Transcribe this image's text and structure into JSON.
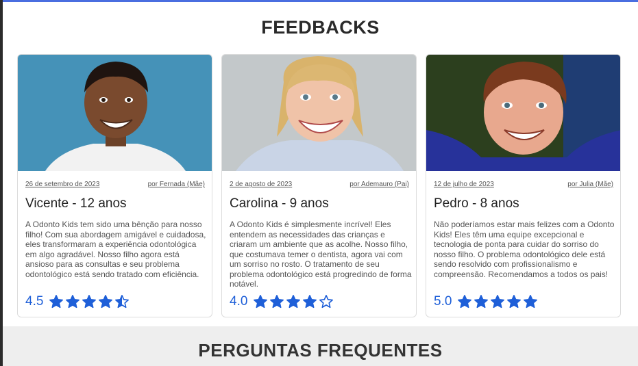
{
  "feedbacks": {
    "title": "FEEDBACKS",
    "cards": [
      {
        "date": "26 de setembro de 2023",
        "author": "por Fernada (Mãe)",
        "name": "Vicente - 12 anos",
        "text": "A Odonto Kids tem sido uma bênção para nosso filho! Com sua abordagem amigável e cuidadosa, eles transformaram a experiência odontológica em algo agradável. Nosso filho agora está ansioso para as consultas e seu problema odontológico está sendo tratado com eficiência.",
        "rating": "4.5",
        "rating_value": 4.5,
        "photo_bg": "#4592b8"
      },
      {
        "date": "2 de agosto de 2023",
        "author": "por Ademauro (Pai)",
        "name": "Carolina - 9 anos",
        "text": "A Odonto Kids é simplesmente incrível! Eles entendem as necessidades das crianças e criaram um ambiente que as acolhe. Nosso filho, que costumava temer o dentista, agora vai com um sorriso no rosto. O tratamento de seu problema odontológico está progredindo de forma notável.",
        "rating": "4.0",
        "rating_value": 4.0,
        "photo_bg": "#b7bcc0"
      },
      {
        "date": "12 de julho de 2023",
        "author": "por Julia (Mãe)",
        "name": "Pedro - 8 anos",
        "text": "Não poderíamos estar mais felizes com a Odonto Kids! Eles têm uma equipe excepcional e tecnologia de ponta para cuidar do sorriso do nosso filho. O problema odontológico dele está sendo resolvido com profissionalismo e compreensão. Recomendamos a todos os pais!",
        "rating": "5.0",
        "rating_value": 5.0,
        "photo_bg": "#2c3f1e"
      }
    ]
  },
  "faq": {
    "title": "PERGUNTAS FREQUENTES"
  },
  "colors": {
    "accent": "#1e5fd8",
    "top_border": "#4a6ee0"
  }
}
